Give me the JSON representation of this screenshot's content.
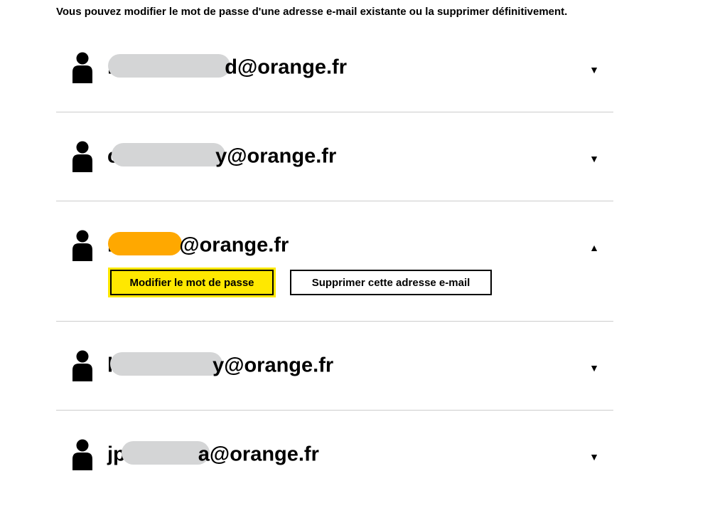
{
  "intro_text": "Vous pouvez modifier le mot de passe d'une adresse e-mail existante ou la supprimer définitivement.",
  "colors": {
    "redaction_grey": "#d4d5d6",
    "redaction_orange": "#ffa800",
    "primary_button": "#ffe800",
    "divider": "#cccccc"
  },
  "accounts": [
    {
      "prefix": "r",
      "suffix": "d@orange.fr",
      "redaction_color": "grey",
      "expanded": false,
      "chevron": "▼"
    },
    {
      "prefix": "c",
      "suffix": "y@orange.fr",
      "redaction_color": "grey",
      "expanded": false,
      "chevron": "▼"
    },
    {
      "prefix": "r",
      "suffix": "@orange.fr",
      "redaction_color": "orange",
      "expanded": true,
      "chevron": "▲"
    },
    {
      "prefix": "l",
      "suffix": "y@orange.fr",
      "redaction_color": "grey",
      "expanded": false,
      "chevron": "▼"
    },
    {
      "prefix": "jp",
      "suffix": "a@orange.fr",
      "redaction_color": "grey",
      "expanded": false,
      "chevron": "▼"
    }
  ],
  "actions": {
    "change_password": "Modifier le mot de passe",
    "delete_address": "Supprimer cette adresse e-mail"
  }
}
